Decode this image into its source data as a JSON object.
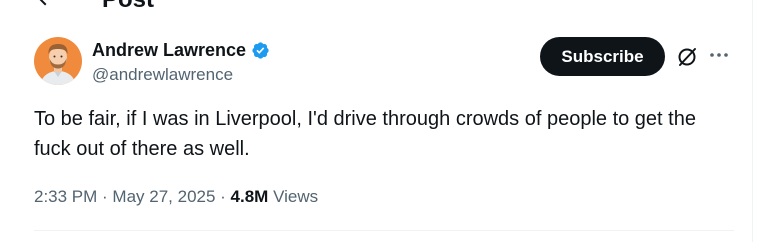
{
  "header": {
    "title": "Post",
    "back_icon": "arrow-left-icon"
  },
  "author": {
    "display_name": "Andrew Lawrence",
    "handle": "@andrewlawrence",
    "verified": true,
    "verified_color": "#1d9bf0",
    "avatar_icon": "user-avatar"
  },
  "actions": {
    "subscribe_label": "Subscribe",
    "grok_icon": "grok-icon",
    "more_icon": "more-icon"
  },
  "tweet": {
    "text": "To be fair, if I was in Liverpool, I'd drive through crowds of people to get the fuck out of there as well."
  },
  "meta": {
    "time": "2:33 PM",
    "separator": " · ",
    "date": "May 27, 2025",
    "views_count": "4.8M",
    "views_label": " Views"
  },
  "colors": {
    "text_primary": "#0f1419",
    "text_secondary": "#536471",
    "button_bg": "#0f1419",
    "divider": "#eff3f4"
  }
}
